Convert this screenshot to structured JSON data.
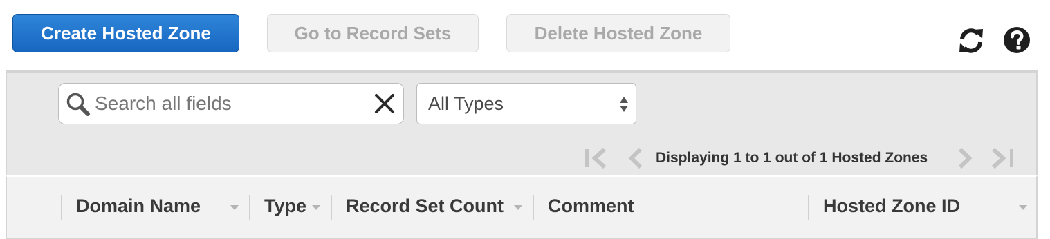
{
  "toolbar": {
    "create_label": "Create Hosted Zone",
    "record_sets_label": "Go to Record Sets",
    "delete_label": "Delete Hosted Zone",
    "refresh_icon": "refresh-icon",
    "help_icon": "help-icon"
  },
  "filters": {
    "search_placeholder": "Search all fields",
    "search_value": "",
    "type_selected": "All Types"
  },
  "pagination": {
    "text": "Displaying 1 to 1 out of 1 Hosted Zones"
  },
  "table": {
    "columns": [
      {
        "label": "Domain Name",
        "sortable": true
      },
      {
        "label": "Type",
        "sortable": true
      },
      {
        "label": "Record Set Count",
        "sortable": true
      },
      {
        "label": "Comment",
        "sortable": false
      },
      {
        "label": "Hosted Zone ID",
        "sortable": true
      }
    ]
  },
  "colors": {
    "primary": "#1f74cf",
    "disabled_text": "#a9a9a9",
    "panel_bg": "#e8e8e8"
  }
}
